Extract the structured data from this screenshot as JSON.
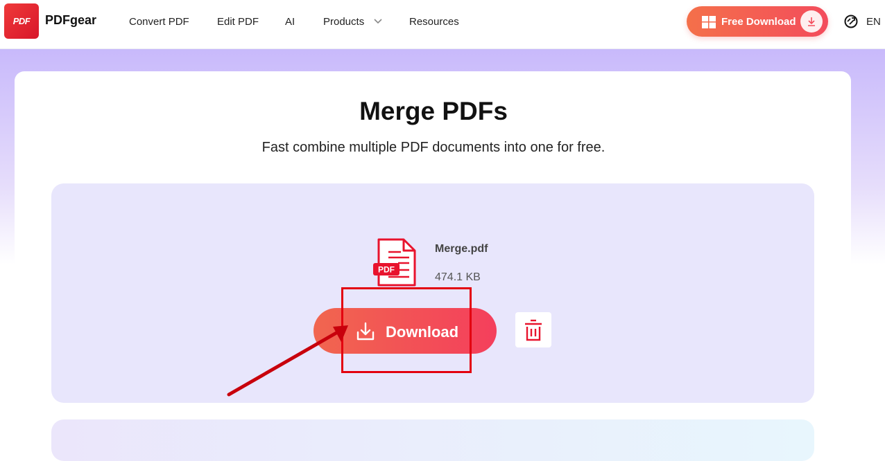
{
  "header": {
    "logo_text": "PDF",
    "brand": "PDFgear",
    "nav": [
      {
        "label": "Convert PDF"
      },
      {
        "label": "Edit PDF"
      },
      {
        "label": "AI"
      },
      {
        "label": "Products"
      },
      {
        "label": "Resources"
      }
    ],
    "free_download": "Free Download",
    "lang": "EN"
  },
  "hero": {
    "title": "Merge PDFs",
    "subtitle": "Fast combine multiple PDF documents into one for free."
  },
  "file": {
    "icon_label": "PDF",
    "name": "Merge.pdf",
    "size": "474.1 KB"
  },
  "actions": {
    "download": "Download"
  },
  "colors": {
    "accent": "#f34c5c",
    "panel": "#e8e6fc",
    "highlight": "#e3000f"
  },
  "icons": [
    "windows-icon",
    "download-icon",
    "translate-icon",
    "chevron-down-icon",
    "pdf-file-icon",
    "trash-icon"
  ]
}
